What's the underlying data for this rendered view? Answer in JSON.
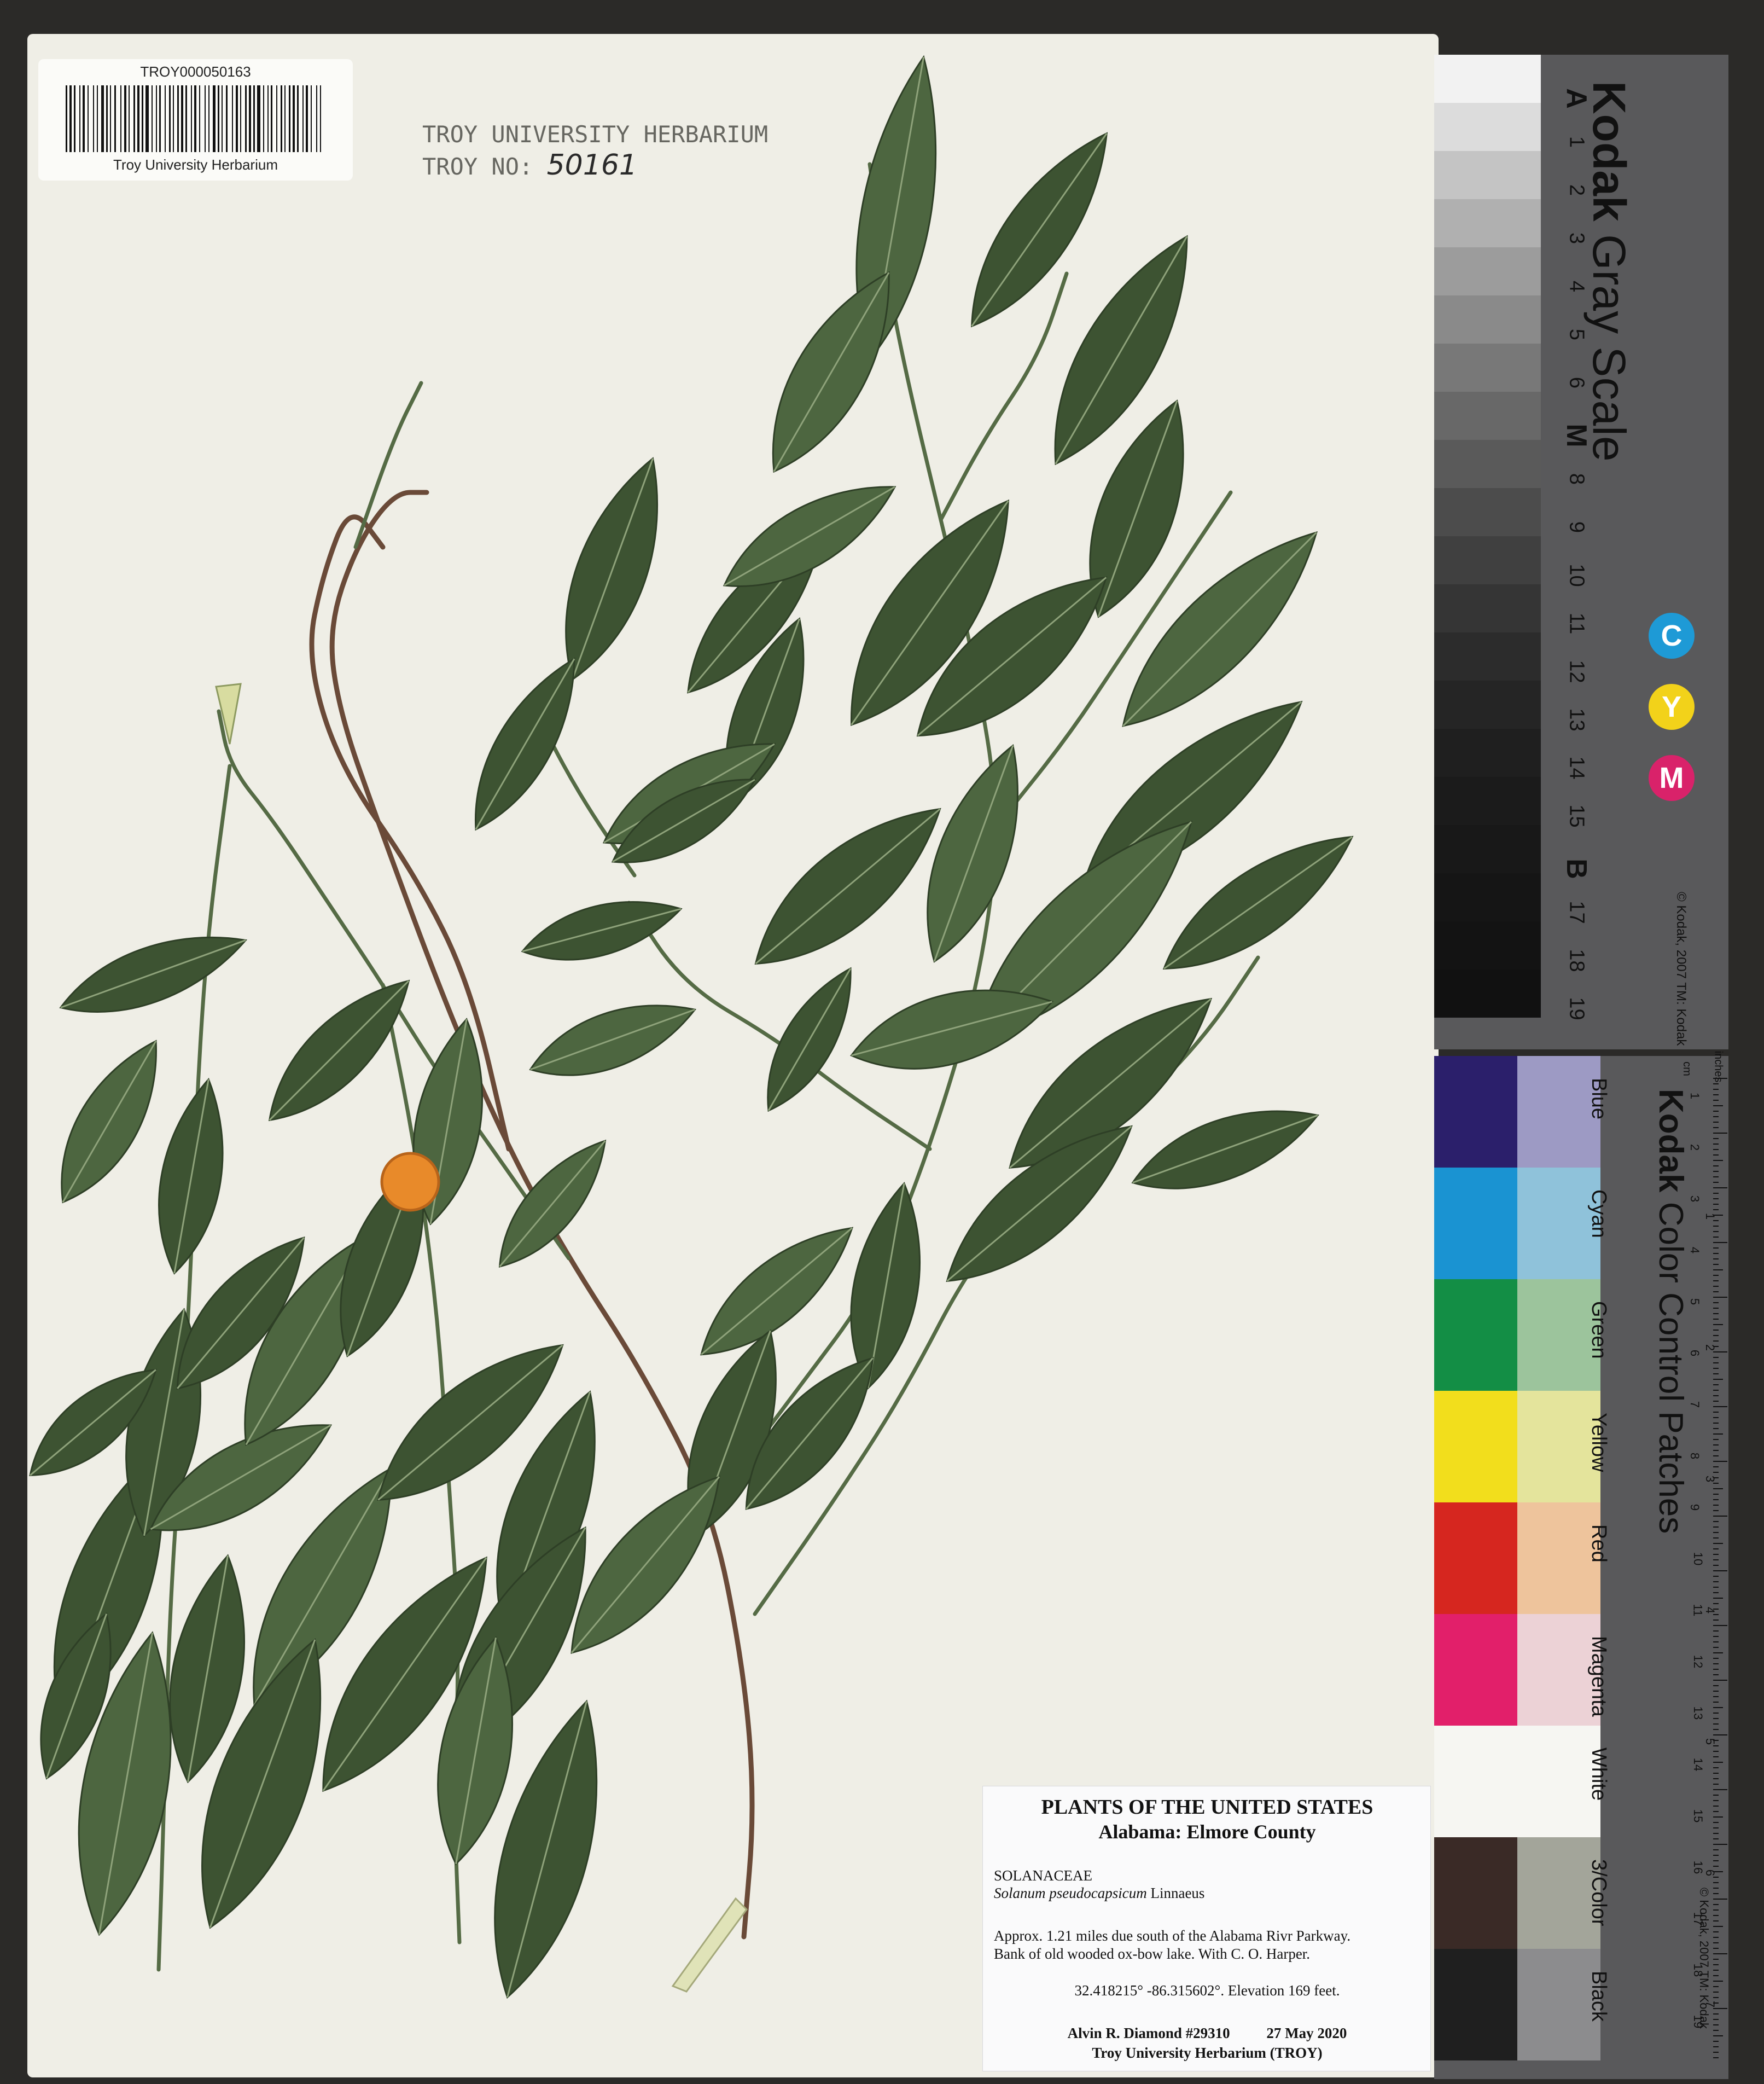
{
  "barcode": {
    "id_text": "TROY000050163",
    "caption": "Troy University Herbarium"
  },
  "stamp": {
    "line1": "TROY UNIVERSITY HERBARIUM",
    "line2_prefix": "TROY NO:",
    "line2_number": "50161"
  },
  "label": {
    "title": "PLANTS OF THE UNITED STATES",
    "region": "Alabama: Elmore County",
    "family": "SOLANACEAE",
    "species": "Solanum pseudocapsicum",
    "author": "Linnaeus",
    "locality_line1": "Approx. 1.21 miles due south of the Alabama Rivr Parkway.",
    "locality_line2": "Bank of old wooded ox-bow lake. With C. O. Harper.",
    "coordinates": "32.418215°  -86.315602°. Elevation 169 feet.",
    "collector": "Alvin R. Diamond #29310",
    "date": "27 May 2020",
    "institution": "Troy University Herbarium (TROY)"
  },
  "gray_scale_card": {
    "brand": "Kodak",
    "product": "Gray Scale",
    "copyright": "© Kodak, 2007 TM: Kodak",
    "steps": [
      "A",
      "1",
      "2",
      "3",
      "4",
      "5",
      "6",
      "M",
      "8",
      "9",
      "10",
      "11",
      "12",
      "13",
      "14",
      "15",
      "B",
      "17",
      "18",
      "19"
    ],
    "cmy": [
      {
        "letter": "C",
        "color": "#1e9ad6"
      },
      {
        "letter": "Y",
        "color": "#f2d21a"
      },
      {
        "letter": "M",
        "color": "#d9226a"
      }
    ]
  },
  "color_control_card": {
    "brand": "Kodak",
    "product": "Color Control Patches",
    "copyright": "© Kodak, 2007 TM: Kodak",
    "patches": [
      {
        "name": "Blue",
        "dark": "#2b1f6b",
        "light": "#9d9ac4"
      },
      {
        "name": "Cyan",
        "dark": "#1a93d2",
        "light": "#8fc2da"
      },
      {
        "name": "Green",
        "dark": "#138e45",
        "light": "#9cc49c"
      },
      {
        "name": "Yellow",
        "dark": "#f2de1c",
        "light": "#e4e49c"
      },
      {
        "name": "Red",
        "dark": "#d6261f",
        "light": "#eec49c"
      },
      {
        "name": "Magenta",
        "dark": "#e21f6a",
        "light": "#ecd2d6"
      },
      {
        "name": "White",
        "dark": "#f6f6f2",
        "light": "#f6f6f2"
      },
      {
        "name": "3/Color",
        "dark": "#3a2a26",
        "light": "#a3a59a"
      },
      {
        "name": "Black",
        "dark": "#1f1f1f",
        "light": "#8c8c8e"
      }
    ],
    "ruler_cm": [
      "1",
      "2",
      "3",
      "4",
      "5",
      "6",
      "7",
      "8",
      "9",
      "10",
      "11",
      "12",
      "13",
      "14",
      "15",
      "16",
      "17",
      "18",
      "19"
    ],
    "ruler_inches": [
      "1",
      "2",
      "3",
      "4",
      "5",
      "6",
      "7"
    ],
    "ruler_unit_cm": "cm",
    "ruler_unit_in": "inches"
  },
  "colors": {
    "sheet": "#efeee6",
    "leaf_dark": "#3d5332",
    "leaf_mid": "#4d6640",
    "stem": "#6a4a38",
    "fruit": "#e88a2a"
  }
}
